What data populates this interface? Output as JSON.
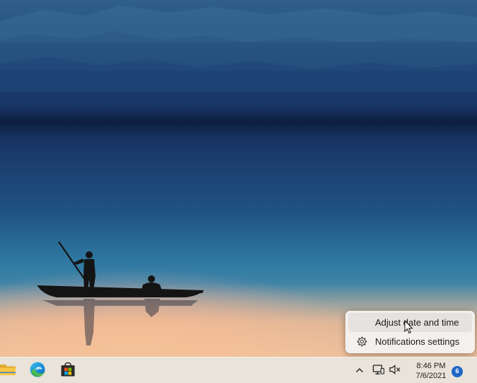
{
  "wallpaper": {
    "description_icon": "lake-boat-silhouette-wallpaper"
  },
  "context_menu": {
    "items": [
      {
        "label": "Adjust date and time",
        "icon": "",
        "hovered": true
      },
      {
        "label": "Notifications settings",
        "icon": "gear-icon",
        "hovered": false
      }
    ]
  },
  "taskbar": {
    "apps": [
      {
        "name": "file-explorer",
        "icon": "folder-icon"
      },
      {
        "name": "microsoft-edge",
        "icon": "edge-icon"
      },
      {
        "name": "microsoft-store",
        "icon": "store-icon"
      }
    ],
    "tray": {
      "icons": [
        "chevron-up-icon",
        "network-icon",
        "speaker-muted-icon"
      ]
    },
    "clock": {
      "time": "8:46 PM",
      "date": "7/6/2021"
    },
    "notifications": {
      "count": "6"
    }
  },
  "colors": {
    "accent": "#1f66c6",
    "taskbar": "#e8e4dc",
    "menu": "#f4f2f0"
  }
}
